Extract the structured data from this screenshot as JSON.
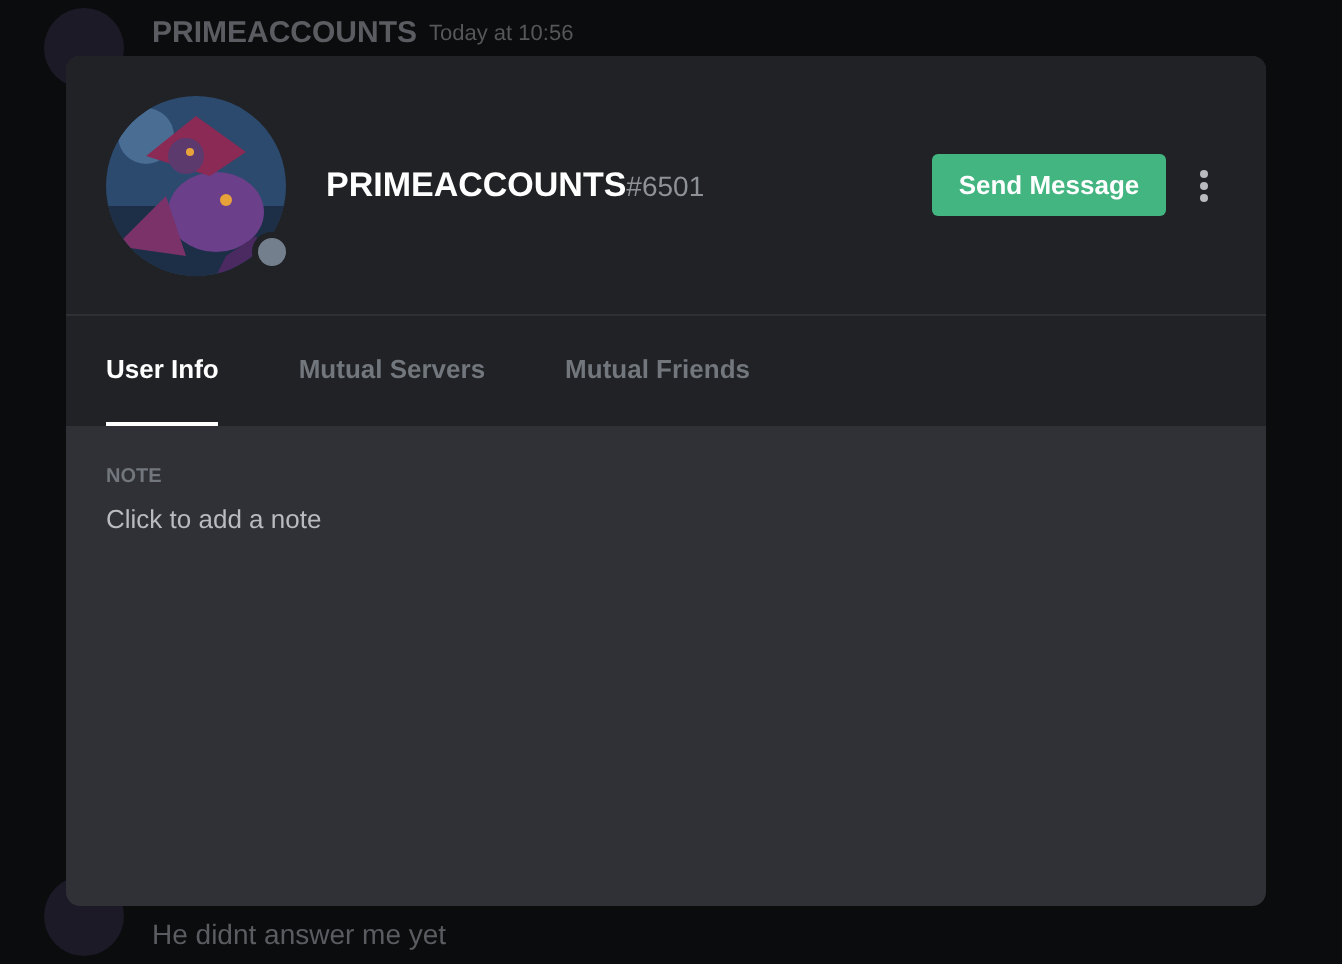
{
  "background_messages": {
    "top": {
      "author": "PRIMEACCOUNTS",
      "time": "Today at 10:56"
    },
    "bottom": {
      "text": "He didnt answer me yet"
    }
  },
  "profile": {
    "username": "PRIMEACCOUNTS",
    "discriminator": "#6501",
    "online": false,
    "send_button": "Send Message"
  },
  "tabs": [
    {
      "label": "User Info",
      "selected": true
    },
    {
      "label": "Mutual Servers",
      "selected": false
    },
    {
      "label": "Mutual Friends",
      "selected": false
    }
  ],
  "note": {
    "heading": "NOTE",
    "placeholder": "Click to add a note"
  }
}
